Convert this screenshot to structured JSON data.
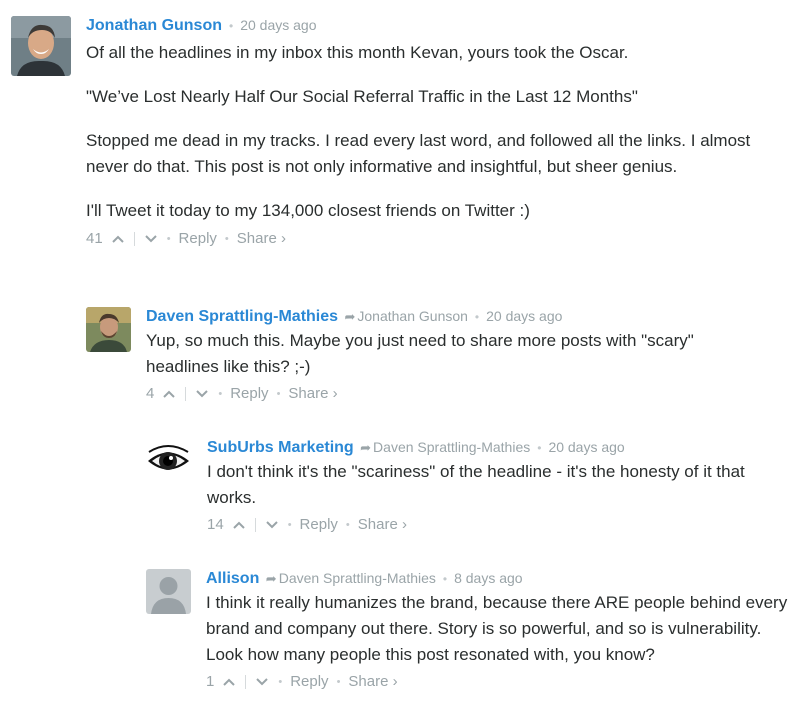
{
  "comments": [
    {
      "author": "Jonathan Gunson",
      "parent": "",
      "time": "20 days ago",
      "paragraphs": [
        "Of all the headlines in my inbox this month Kevan, yours took the Oscar.",
        "\"We’ve Lost Nearly Half Our Social Referral Traffic in the Last 12 Months\"",
        "Stopped me dead in my tracks. I read every last word, and followed all the links. I almost never do that. This post is not only informative and insightful, but sheer genius.",
        "I'll Tweet it today to my 134,000 closest friends on Twitter :)"
      ],
      "votes": "41"
    },
    {
      "author": "Daven Sprattling-Mathies",
      "parent": "Jonathan Gunson",
      "time": "20 days ago",
      "paragraphs": [
        "Yup, so much this. Maybe you just need to share more posts with \"scary\" headlines like this? ;-)"
      ],
      "votes": "4"
    },
    {
      "author": "SubUrbs Marketing",
      "parent": "Daven Sprattling-Mathies",
      "time": "20 days ago",
      "paragraphs": [
        "I don't think it's the \"scariness\" of the headline - it's the honesty of it that works."
      ],
      "votes": "14"
    },
    {
      "author": "Allison",
      "parent": "Daven Sprattling-Mathies",
      "time": "8 days ago",
      "paragraphs": [
        "I think it really humanizes the brand, because there ARE people behind every brand and company out there. Story is so powerful, and so is vulnerability. Look how many people this post resonated with, you know?"
      ],
      "votes": "1"
    }
  ],
  "labels": {
    "reply": "Reply",
    "share": "Share ›",
    "reply_arrow": "➦",
    "separator": "•"
  },
  "colors": {
    "author": "#2a88d5",
    "meta": "#9aa4a8",
    "text": "#2a2e2e"
  }
}
